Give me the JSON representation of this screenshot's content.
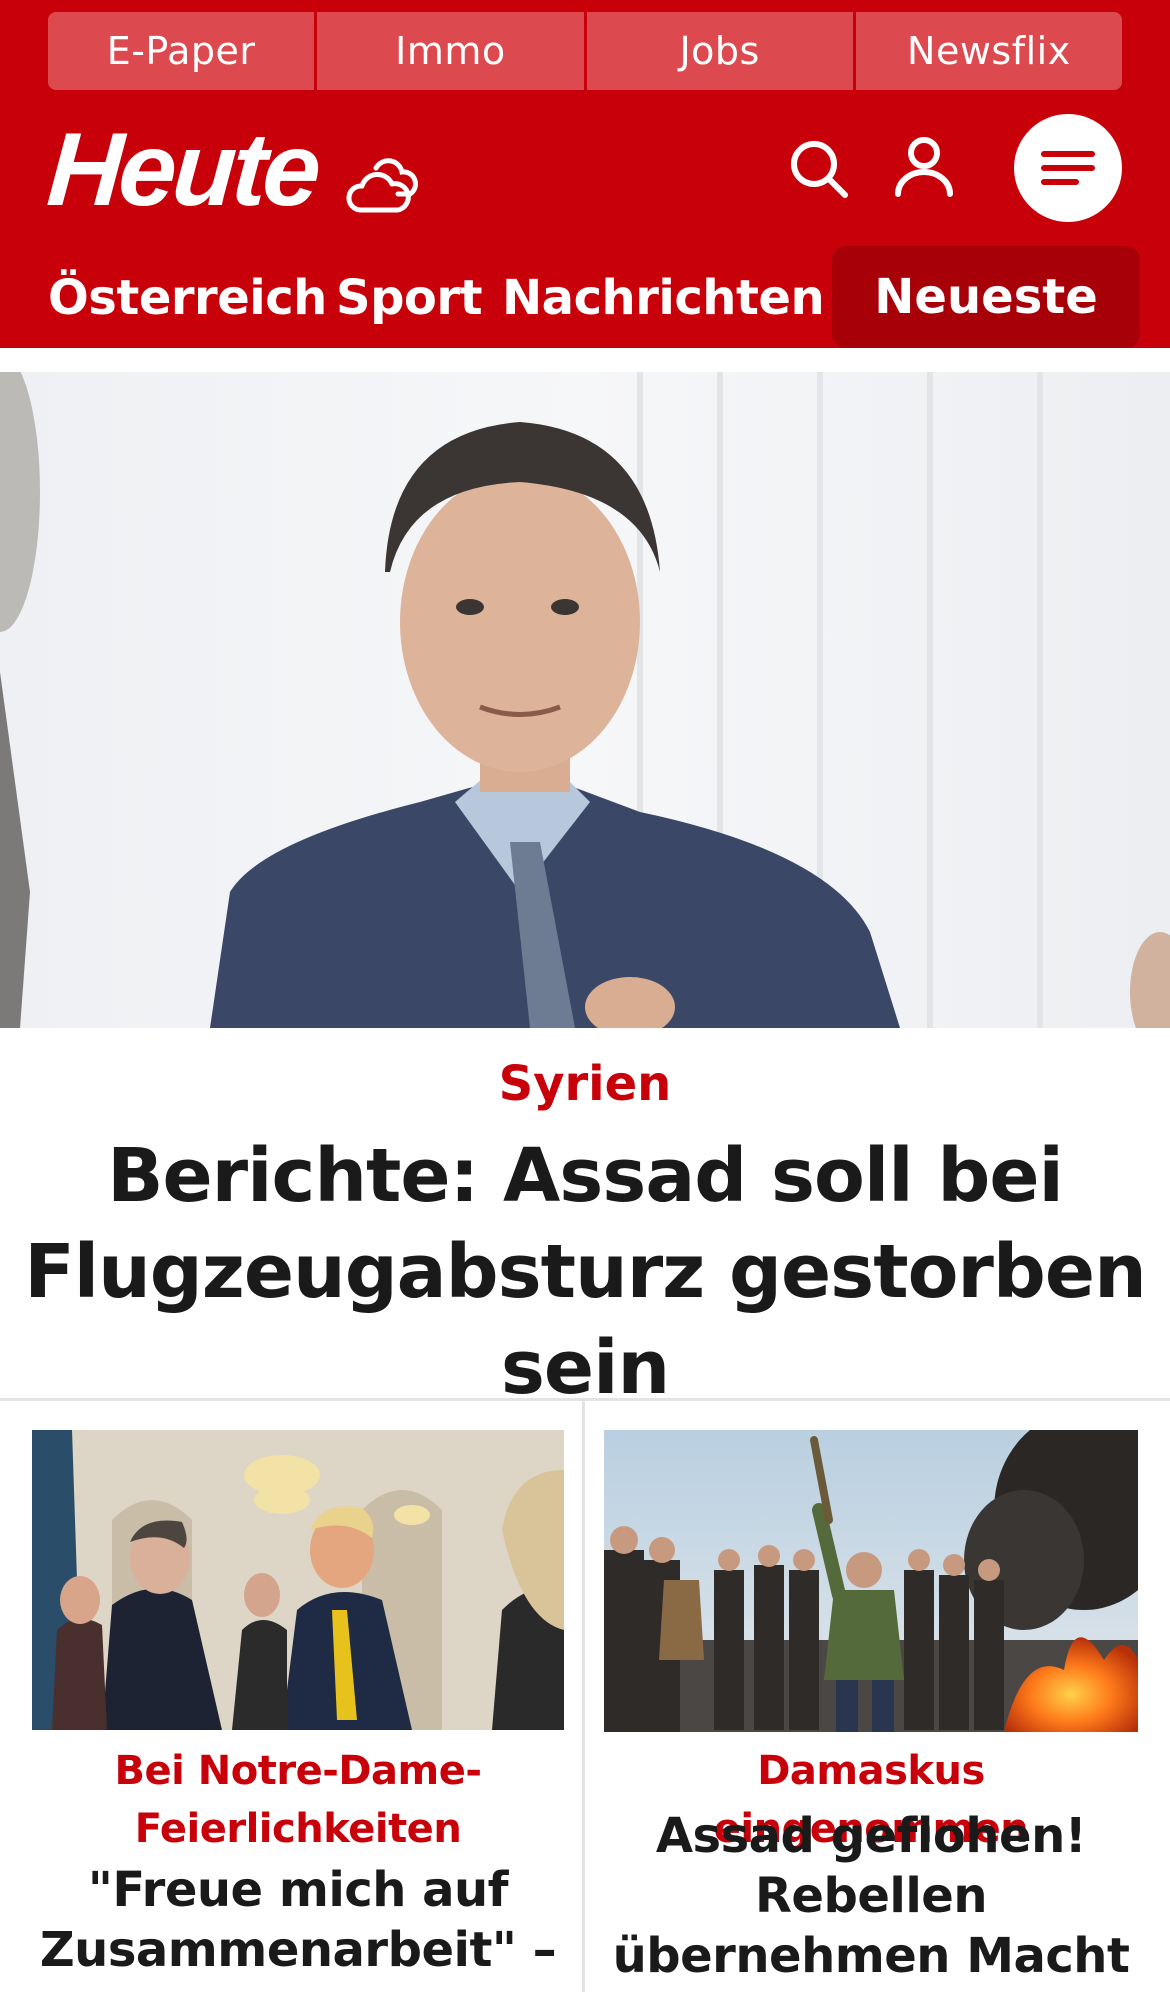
{
  "service_bar": {
    "items": [
      {
        "label": "E-Paper"
      },
      {
        "label": "Immo"
      },
      {
        "label": "Jobs"
      },
      {
        "label": "Newsflix"
      }
    ]
  },
  "header": {
    "logo": "Heute",
    "icons": [
      "weather-cloud-icon",
      "search-icon",
      "user-icon",
      "menu-icon"
    ]
  },
  "nav": {
    "items": [
      {
        "label": "Österreich"
      },
      {
        "label": "Sport"
      },
      {
        "label": "Nachrichten"
      }
    ],
    "highlight": "Neueste"
  },
  "hero": {
    "kicker": "Syrien",
    "headline": "Berichte: Assad soll bei Flugzeugabsturz gestorben sein"
  },
  "teasers": [
    {
      "kicker": "Bei Notre-Dame-Feierlichkeiten",
      "headline": "\"Freue mich auf Zusammenarbeit\" –"
    },
    {
      "kicker": "Damaskus eingenommen",
      "headline": "Assad geflohen! Rebellen übernehmen Macht in Syrien"
    }
  ],
  "colors": {
    "brand_red": "#c8000a",
    "service_bar_bg": "#dc4a4f",
    "nav_highlight": "#a70008",
    "headline_text": "#1a1a1a"
  }
}
